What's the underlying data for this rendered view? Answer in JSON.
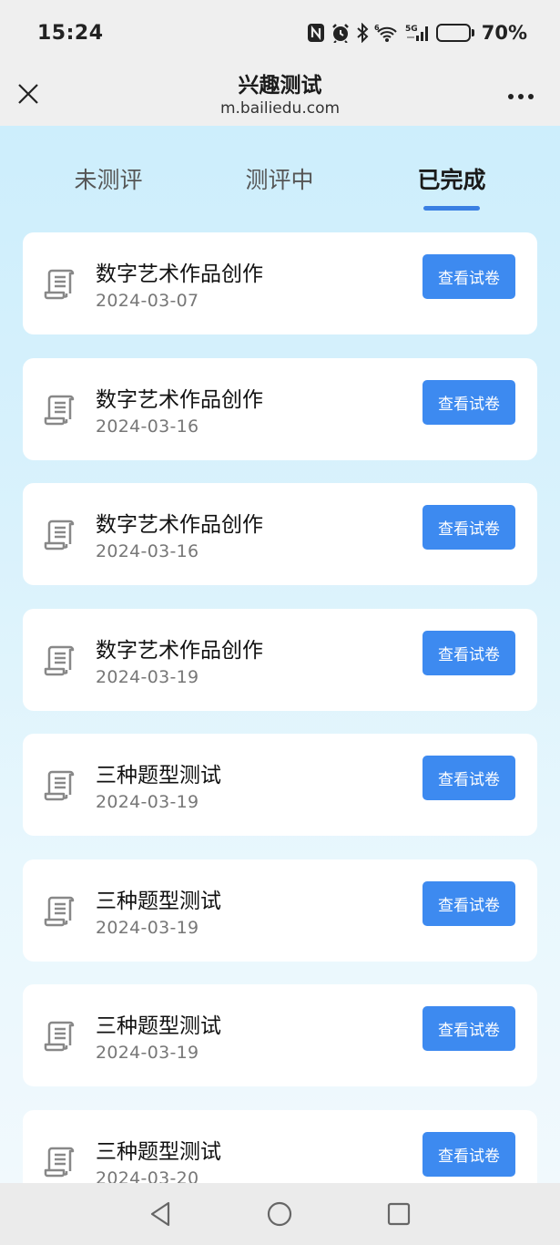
{
  "status_bar": {
    "time": "15:24",
    "icons": [
      "nfc-icon",
      "alarm-icon",
      "bluetooth-icon",
      "wifi-6-icon",
      "signal-5g-icon"
    ],
    "battery_percent": "70%",
    "battery_level": 0.7
  },
  "nav": {
    "title": "兴趣测试",
    "url": "m.bailiedu.com",
    "more": "•••"
  },
  "tabs": [
    {
      "label": "未测评",
      "active": false
    },
    {
      "label": "测评中",
      "active": false
    },
    {
      "label": "已完成",
      "active": true
    }
  ],
  "items": [
    {
      "title": "数字艺术作品创作",
      "date": "2024-03-07",
      "button": "查看试卷"
    },
    {
      "title": "数字艺术作品创作",
      "date": "2024-03-16",
      "button": "查看试卷"
    },
    {
      "title": "数字艺术作品创作",
      "date": "2024-03-16",
      "button": "查看试卷"
    },
    {
      "title": "数字艺术作品创作",
      "date": "2024-03-19",
      "button": "查看试卷"
    },
    {
      "title": "三种题型测试",
      "date": "2024-03-19",
      "button": "查看试卷"
    },
    {
      "title": "三种题型测试",
      "date": "2024-03-19",
      "button": "查看试卷"
    },
    {
      "title": "三种题型测试",
      "date": "2024-03-19",
      "button": "查看试卷"
    },
    {
      "title": "三种题型测试",
      "date": "2024-03-20",
      "button": "查看试卷"
    }
  ],
  "colors": {
    "accent": "#3d8af0",
    "tab_underline": "#3a7fe3"
  }
}
